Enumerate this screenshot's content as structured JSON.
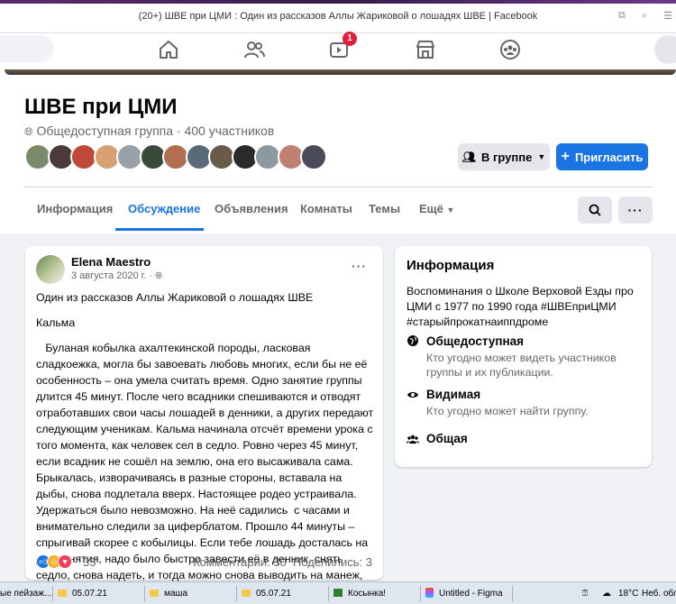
{
  "window": {
    "title": "(20+) ШВЕ при ЦМИ : Один из рассказов Аллы Жариковой о лошадях ШВЕ | Facebook"
  },
  "topnav": {
    "watch_badge": "1"
  },
  "group": {
    "name": "ШВЕ при ЦМИ",
    "privacy_icon": "globe-icon",
    "meta": "Общедоступная группа · 400 участников",
    "member_avatar_colors": [
      "#7a8a6a",
      "#4a3a3a",
      "#c04a3a",
      "#d8a070",
      "#9aa0a8",
      "#3a4a3a",
      "#b07050",
      "#5a6a7a",
      "#6a5a4a",
      "#2a2a2a",
      "#8a9aa0",
      "#c08070",
      "#4a4a5a"
    ],
    "in_group_button": "В группе",
    "invite_button": "Пригласить"
  },
  "tabs": [
    {
      "label": "Информация"
    },
    {
      "label": "Обсуждение"
    },
    {
      "label": "Объявления"
    },
    {
      "label": "Комнаты"
    },
    {
      "label": "Темы"
    },
    {
      "label": "Ещё"
    }
  ],
  "post": {
    "author": "Elena Maestro",
    "date": "3 августа 2020 г. ·",
    "title": "Один из рассказов Аллы Жариковой о лошадях ШВЕ",
    "subtitle": "Кальма",
    "body": "   Буланая кобылка ахалтекинской породы, ласковая сладкоежка, могла бы завоевать любовь многих, если бы не её особенность – она умела считать время. Одно занятие группы длится 45 минут. После чего всадники спешиваются и отводят отработавших свои часы лошадей в денники, а других передают следующим ученикам. Кальма начинала отсчёт времени урока с того момента, как человек сел в седло. Ровно через 45 минут, если всадник не сошёл на землю, она его высаживала сама. Брыкалась, изворачиваясь в разные стороны, вставала на дыбы, снова подлетала вверх. Настоящее родео устраивала. Удержаться было невозможно. На неё садились  с часами и внимательно следили за циферблатом. Прошло 44 минуты – спрыгивай скорее с кобылицы. Если тебе лошадь досталась на два занятия, надо было быстро завести её в денник, снять седло, снова надеть, и тогда можно снова выводить на манеж, садиться верхом и продолжать внимательно следить за временем.",
    "reactions_count": "35",
    "comments": "Комментарии: 30",
    "shares": "Поделились: 3"
  },
  "info": {
    "title": "Информация",
    "description": "Воспоминания о Школе Верховой Езды про ЦМИ с 1977 по 1990 года #ШВЕприЦМИ #старыйпрокатнаиппдроме",
    "public_title": "Общедоступная",
    "public_sub": "Кто угодно может видеть участников группы и их публикации.",
    "visible_title": "Видимая",
    "visible_sub": "Кто угодно может найти группу.",
    "general_title": "Общая"
  },
  "taskbar": {
    "items": [
      "ые пейзаж...",
      "05.07.21",
      "маша",
      "05.07.21",
      "Косынка!",
      "Untitled - Figma"
    ],
    "temp": "18°C",
    "weather": "Неб. обла"
  },
  "colors": {
    "accent": "#1b74e4",
    "badge": "#e41e3f"
  }
}
